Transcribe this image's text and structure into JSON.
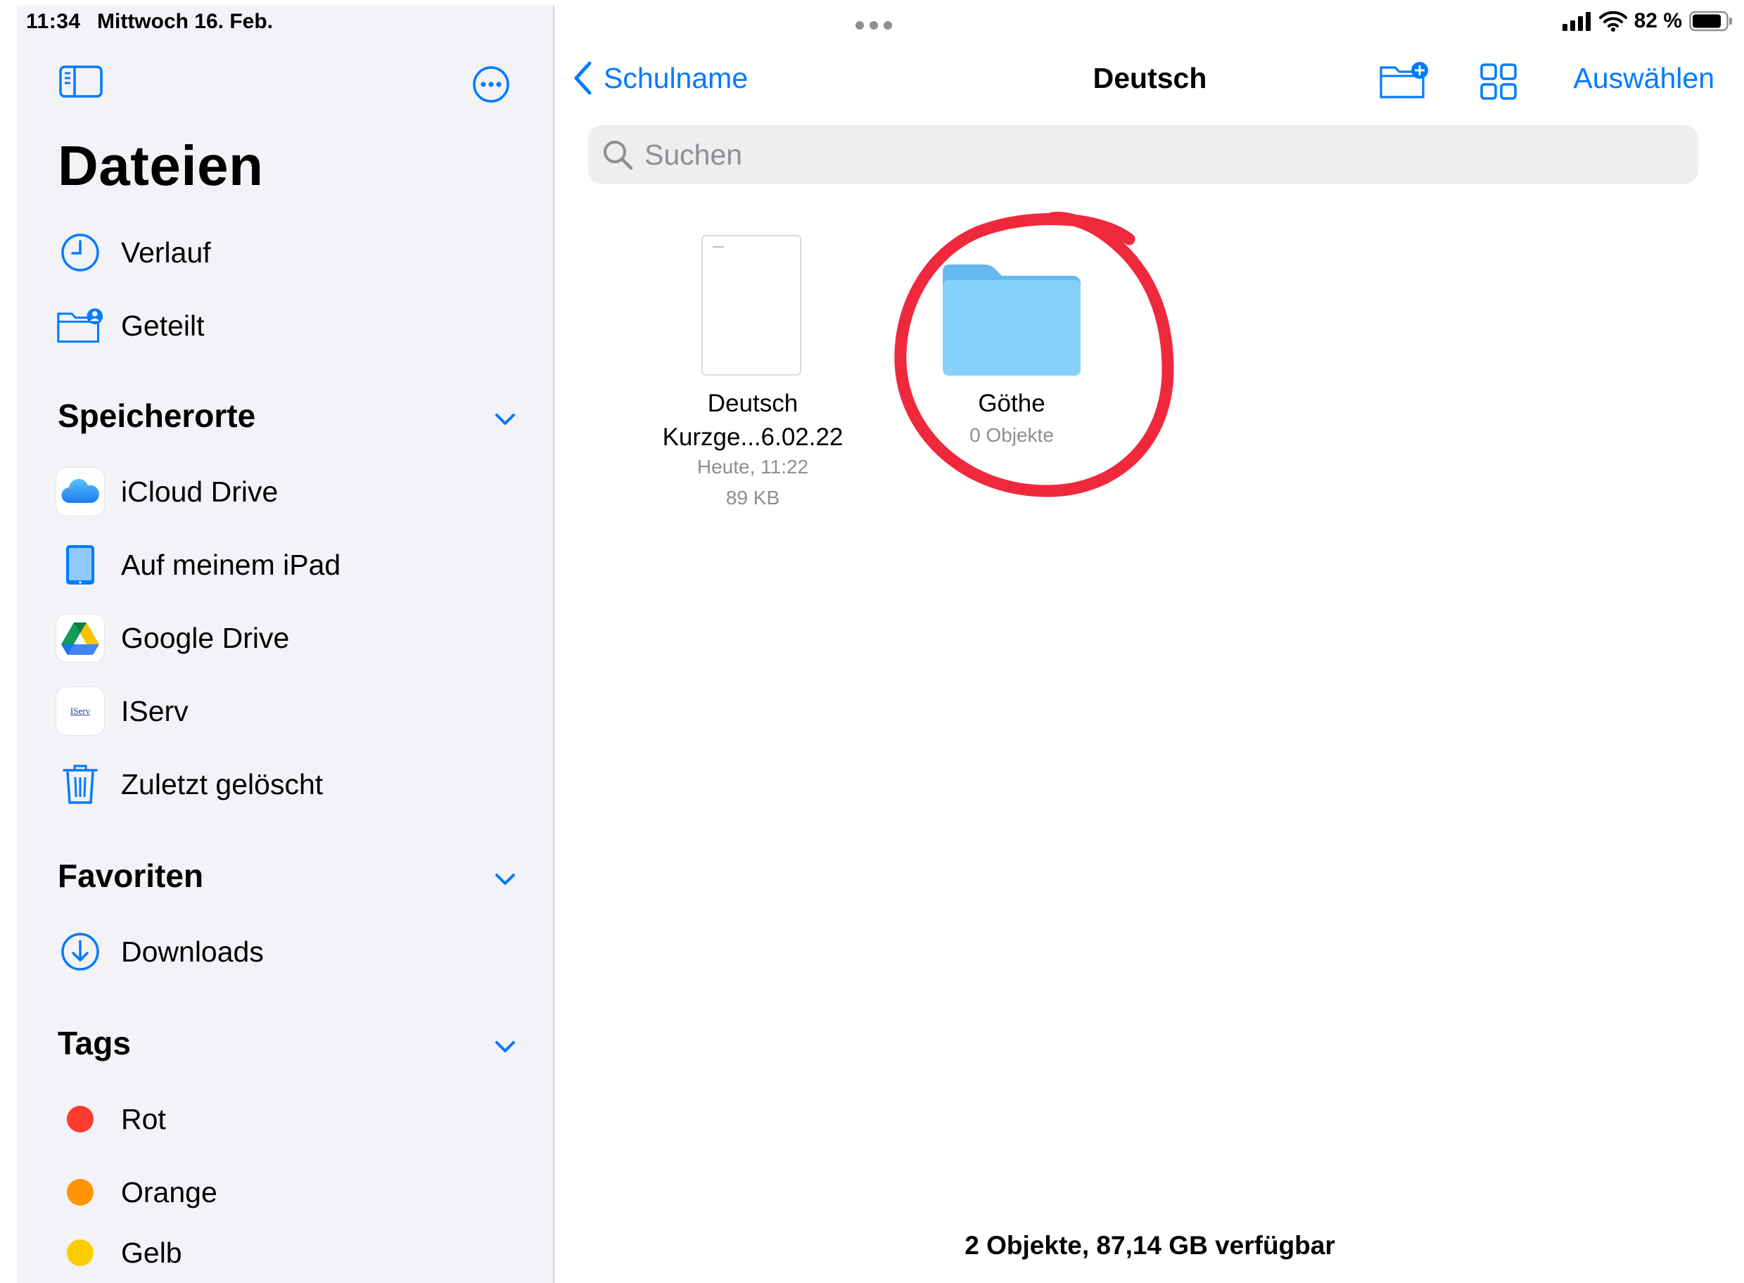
{
  "status": {
    "time": "11:34",
    "date": "Mittwoch 16. Feb.",
    "battery": "82 %"
  },
  "sidebar": {
    "title": "Dateien",
    "top_items": [
      {
        "label": "Verlauf",
        "icon": "clock-icon"
      },
      {
        "label": "Geteilt",
        "icon": "shared-folder-icon"
      }
    ],
    "locations": {
      "heading": "Speicherorte",
      "items": [
        {
          "label": "iCloud Drive",
          "icon": "icloud-icon"
        },
        {
          "label": "Auf meinem iPad",
          "icon": "ipad-icon"
        },
        {
          "label": "Google Drive",
          "icon": "google-drive-icon"
        },
        {
          "label": "IServ",
          "icon": "iserv-icon",
          "logo_text": "IServ"
        },
        {
          "label": "Zuletzt gelöscht",
          "icon": "trash-icon"
        }
      ]
    },
    "favorites": {
      "heading": "Favoriten",
      "items": [
        {
          "label": "Downloads",
          "icon": "download-icon"
        }
      ]
    },
    "tags": {
      "heading": "Tags",
      "items": [
        {
          "label": "Rot",
          "color": "#ff3b30"
        },
        {
          "label": "Orange",
          "color": "#ff9500"
        },
        {
          "label": "Gelb",
          "color": "#ffcc00"
        }
      ]
    }
  },
  "main": {
    "back_label": "Schulname",
    "title": "Deutsch",
    "select_label": "Auswählen",
    "search_placeholder": "Suchen",
    "files": [
      {
        "name_line1": "Deutsch",
        "name_line2": "Kurzge...6.02.22",
        "date": "Heute, 11:22",
        "size": "89 KB"
      }
    ],
    "folders": [
      {
        "name": "Göthe",
        "count": "0 Objekte"
      }
    ],
    "footer": "2 Objekte, 87,14 GB verfügbar"
  },
  "colors": {
    "accent": "#007aff",
    "folder": "#7cc8f5",
    "annotation": "#f0283c"
  }
}
